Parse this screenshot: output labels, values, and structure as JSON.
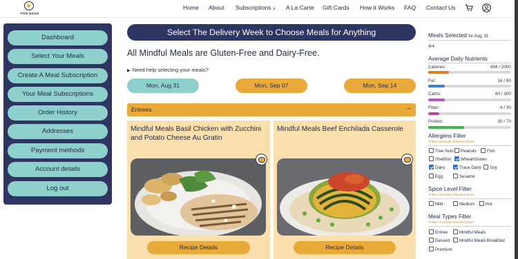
{
  "brand": {
    "logo_text": "FIVE EGGS"
  },
  "nav": {
    "home": "Home",
    "about": "About",
    "subscriptions": "Subscriptions",
    "subscriptions_caret": "∨",
    "a_la_carte": "A La Carte",
    "gift_cards": "Gift Cards",
    "how_it_works": "How it Works",
    "faq": "FAQ",
    "contact_us": "Contact Us"
  },
  "icons": {
    "cart": "cart-icon",
    "user": "user-icon"
  },
  "sidebar": {
    "items": [
      {
        "label": "Dashboard"
      },
      {
        "label": "Select Your Meals"
      },
      {
        "label": "Create A Meal Subscription"
      },
      {
        "label": "Your Meal Subscriptions"
      },
      {
        "label": "Order History"
      },
      {
        "label": "Addresses"
      },
      {
        "label": "Payment methods"
      },
      {
        "label": "Account details"
      },
      {
        "label": "Log out"
      }
    ]
  },
  "main": {
    "banner": "Select The Delivery Week to Choose Meals for Anything",
    "headline": "All Mindful Meals are Gluten-Free and Dairy-Free.",
    "help_toggle": "▶",
    "help_text": "Need help selecting your meals?",
    "weeks": [
      {
        "label": "Mon, Aug 31",
        "selected": true
      },
      {
        "label": "Mon, Sep 07",
        "selected": false
      },
      {
        "label": "Mon, Sep 14",
        "selected": false
      }
    ],
    "section": {
      "label": "Entrees",
      "collapse": "−"
    },
    "meals": [
      {
        "title": "Mindful Meals Basil Chicken with Zucchini and Potato Cheese Au Gratin",
        "button": "Recipe Details"
      },
      {
        "title": "Mindful Meals Beef Enchilada Casserole",
        "button": "Recipe Details"
      }
    ]
  },
  "summary": {
    "meals_selected_label": "Meals Selected",
    "meals_selected_for": "for Aug, 31",
    "meals_selected_count": "4/4",
    "nutrients_title": "Average Daily Nutrients",
    "nutrients": [
      {
        "name": "Calories:",
        "value": "494 / 2000",
        "fraction": 0.247,
        "color": "#e07b2a"
      },
      {
        "name": "Fat:",
        "value": "16 / 80",
        "fraction": 0.2,
        "color": "#3f7fd0"
      },
      {
        "name": "Carbs:",
        "value": "60 / 300",
        "fraction": 0.2,
        "color": "#b455c9"
      },
      {
        "name": "Fiber:",
        "value": "4 / 30",
        "fraction": 0.133,
        "color": "#c2479b"
      },
      {
        "name": "Protein:",
        "value": "30 / 70",
        "fraction": 0.43,
        "color": "#3cb54a"
      }
    ]
  },
  "filters": {
    "allergens": {
      "title": "Allergens Filter",
      "note": "*Filters Exclude Checked Items",
      "options": [
        {
          "label": "Tree Nuts",
          "checked": false
        },
        {
          "label": "Peanuts",
          "checked": false
        },
        {
          "label": "Fish",
          "checked": false
        },
        {
          "label": "Shellfish",
          "checked": false
        },
        {
          "label": "Wheat/Gluten",
          "checked": true
        },
        {
          "label": "Dairy",
          "checked": true
        },
        {
          "label": "Trace Dairy",
          "checked": true
        },
        {
          "label": "Soy",
          "checked": false
        },
        {
          "label": "Egg",
          "checked": false
        },
        {
          "label": "Sesame",
          "checked": false
        }
      ]
    },
    "spice": {
      "title": "Spice Level Filter",
      "note": "*Filters Exclude Checked Items",
      "options": [
        {
          "label": "Mild",
          "checked": false
        },
        {
          "label": "Medium",
          "checked": false
        },
        {
          "label": "Hot",
          "checked": false
        }
      ]
    },
    "meal_types": {
      "title": "Meal Types Filter",
      "note": "*Filters Exclude Checked Items",
      "options": [
        {
          "label": "Entree",
          "checked": false
        },
        {
          "label": "Mindful Meals",
          "checked": false
        },
        {
          "label": "Dessert",
          "checked": false
        },
        {
          "label": "Mindful Meals Breakfast",
          "checked": false
        },
        {
          "label": "Premium",
          "checked": false
        }
      ]
    }
  },
  "colors": {
    "navy": "#2e3563",
    "teal": "#8ed0cb",
    "gold": "#e9aa39",
    "card": "#fbe0ae"
  }
}
